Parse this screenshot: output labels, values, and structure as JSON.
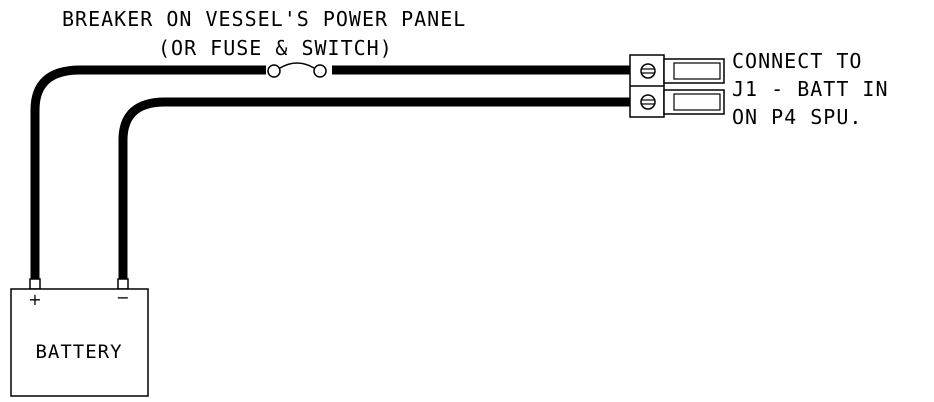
{
  "breaker_label": {
    "line1": "BREAKER ON VESSEL'S POWER PANEL",
    "line2": "(OR FUSE & SWITCH)"
  },
  "connector_label": {
    "line1": "CONNECT TO",
    "line2": "J1 - BATT IN",
    "line3": "ON P4 SPU."
  },
  "battery": {
    "label": "BATTERY",
    "positive_symbol": "+",
    "negative_symbol": "−"
  },
  "colors": {
    "line": "#000000",
    "background": "#ffffff"
  }
}
